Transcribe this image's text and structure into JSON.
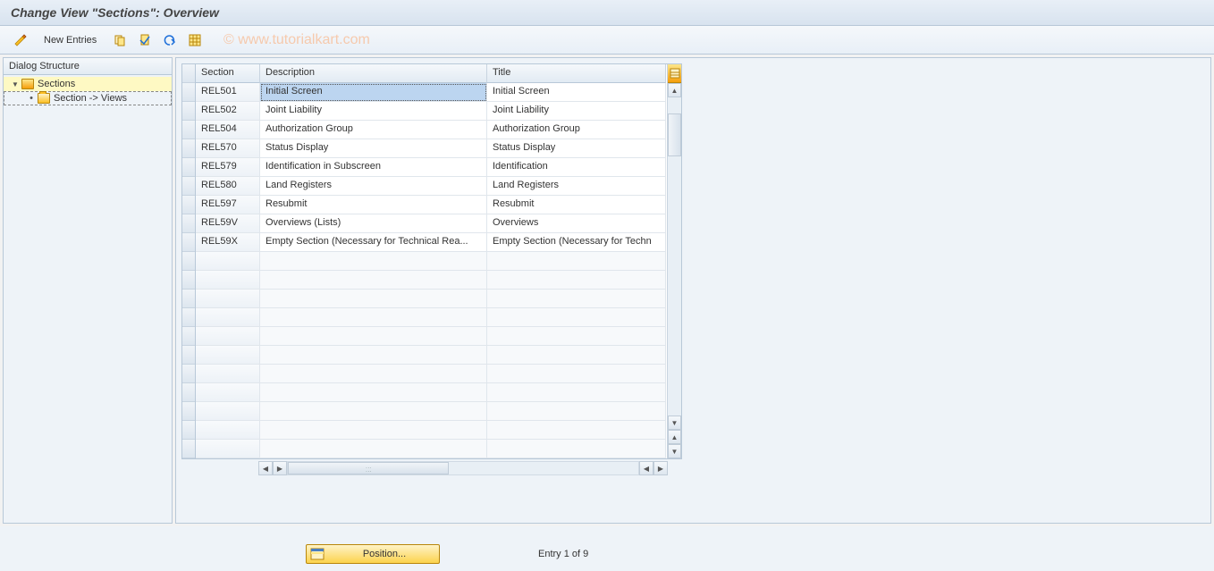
{
  "title": "Change View \"Sections\": Overview",
  "watermark": "©  www.tutorialkart.com",
  "toolbar": {
    "new_entries_label": "New Entries"
  },
  "sidebar": {
    "header": "Dialog Structure",
    "items": [
      {
        "label": "Sections",
        "expanded": true,
        "selected": true,
        "icon": "folder-open"
      },
      {
        "label": "Section -> Views",
        "expanded": false,
        "selected": false,
        "icon": "folder-closed"
      }
    ]
  },
  "table": {
    "columns": [
      "Section",
      "Description",
      "Title"
    ],
    "rows": [
      {
        "section": "REL501",
        "description": "Initial Screen",
        "title": "Initial Screen",
        "selected": true
      },
      {
        "section": "REL502",
        "description": "Joint Liability",
        "title": "Joint Liability"
      },
      {
        "section": "REL504",
        "description": "Authorization Group",
        "title": "Authorization Group"
      },
      {
        "section": "REL570",
        "description": "Status Display",
        "title": "Status Display"
      },
      {
        "section": "REL579",
        "description": "Identification in Subscreen",
        "title": "Identification"
      },
      {
        "section": "REL580",
        "description": "Land Registers",
        "title": "Land Registers"
      },
      {
        "section": "REL597",
        "description": "Resubmit",
        "title": "Resubmit"
      },
      {
        "section": "REL59V",
        "description": "Overviews (Lists)",
        "title": "Overviews"
      },
      {
        "section": "REL59X",
        "description": "Empty Section (Necessary for Technical Rea...",
        "title": "Empty Section (Necessary for Techn"
      }
    ],
    "empty_rows": 11
  },
  "footer": {
    "position_label": "Position...",
    "entry_info": "Entry 1 of 9"
  }
}
